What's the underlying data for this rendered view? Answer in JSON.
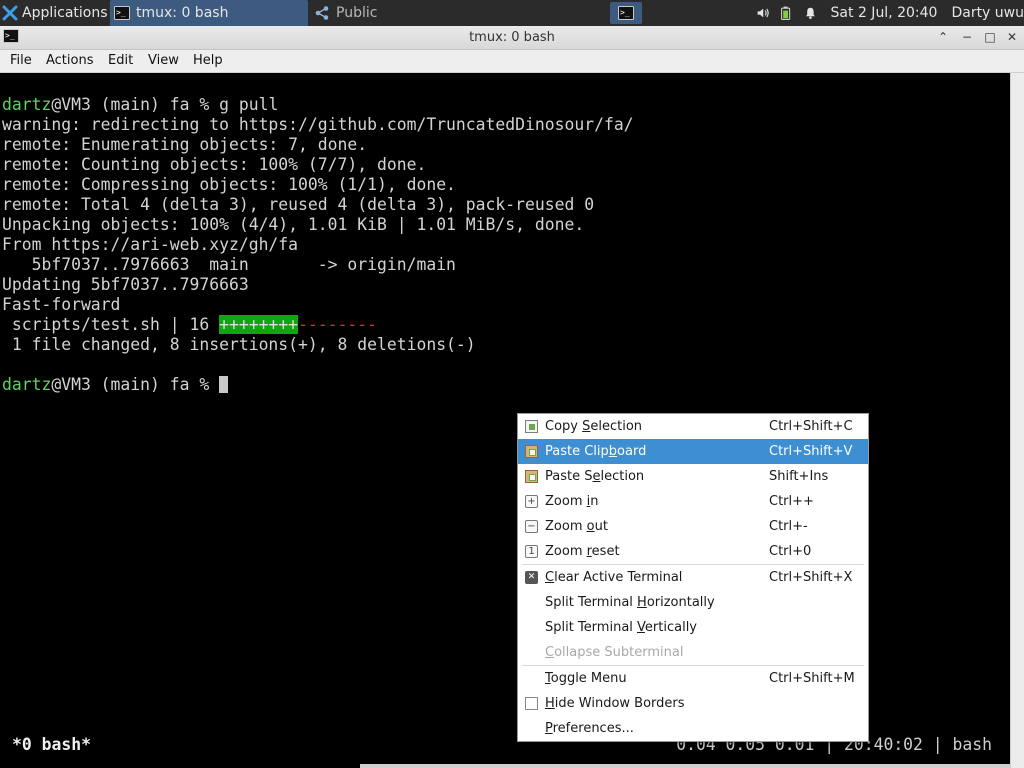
{
  "panel": {
    "apps_label": "Applications",
    "task1_label": "tmux: 0 bash",
    "task2_label": "Public",
    "terminal_glyph": ">_",
    "clock": "Sat  2 Jul, 20:40",
    "user": "Darty uwu",
    "icons": [
      "applications-icon",
      "terminal-icon",
      "share-icon",
      "volume-icon",
      "battery-icon",
      "notification-bell-icon"
    ]
  },
  "window": {
    "title": "tmux: 0 bash",
    "controls": {
      "up": "⌃",
      "minimize": "−",
      "maximize": "□",
      "close": "✕"
    }
  },
  "menubar": {
    "items": [
      "File",
      "Actions",
      "Edit",
      "View",
      "Help"
    ]
  },
  "terminal": {
    "prompt_user": "dartz",
    "prompt_rest": "@VM3 (main) fa % ",
    "command": "g pull",
    "lines": [
      "warning: redirecting to https://github.com/TruncatedDinosour/fa/",
      "remote: Enumerating objects: 7, done.",
      "remote: Counting objects: 100% (7/7), done.",
      "remote: Compressing objects: 100% (1/1), done.",
      "remote: Total 4 (delta 3), reused 4 (delta 3), pack-reused 0",
      "Unpacking objects: 100% (4/4), 1.01 KiB | 1.01 MiB/s, done.",
      "From https://ari-web.xyz/gh/fa",
      "   5bf7037..7976663  main       -> origin/main",
      "Updating 5bf7037..7976663",
      "Fast-forward"
    ],
    "diffstat_prefix": " scripts/test.sh | 16 ",
    "diffstat_plus": "++++++++",
    "diffstat_minus": "--------",
    "summary": " 1 file changed, 8 insertions(+), 8 deletions(-)",
    "prompt2_user": "dartz",
    "prompt2_rest": "@VM3 (main) fa % "
  },
  "status": {
    "left": "*0 bash*",
    "right": "0.04 0.05 0.01 | 20:40:02 | bash"
  },
  "context_menu": {
    "copy_selection": {
      "pre": "Copy ",
      "u": "S",
      "post": "election",
      "shortcut": "Ctrl+Shift+C"
    },
    "paste_clipboard": {
      "pre": "Paste Clip",
      "u": "b",
      "post": "oard",
      "shortcut": "Ctrl+Shift+V"
    },
    "paste_selection": {
      "pre": "Paste S",
      "u": "e",
      "post": "lection",
      "shortcut": "Shift+Ins"
    },
    "zoom_in": {
      "pre": "Zoom ",
      "u": "i",
      "post": "n",
      "shortcut": "Ctrl++"
    },
    "zoom_out": {
      "pre": "Zoom ",
      "u": "o",
      "post": "ut",
      "shortcut": "Ctrl+-"
    },
    "zoom_reset": {
      "pre": "Zoom ",
      "u": "r",
      "post": "eset",
      "shortcut": "Ctrl+0"
    },
    "clear_terminal": {
      "pre": "",
      "u": "C",
      "post": "lear Active Terminal",
      "shortcut": "Ctrl+Shift+X"
    },
    "split_h": {
      "pre": "Split Terminal ",
      "u": "H",
      "post": "orizontally"
    },
    "split_v": {
      "pre": "Split Terminal ",
      "u": "V",
      "post": "ertically"
    },
    "collapse": {
      "pre": "",
      "u": "C",
      "post": "ollapse Subterminal"
    },
    "toggle_menu": {
      "pre": "",
      "u": "T",
      "post": "oggle Menu",
      "shortcut": "Ctrl+Shift+M"
    },
    "hide_borders": {
      "pre": "",
      "u": "H",
      "post": "ide Window Borders"
    },
    "preferences": {
      "pre": "",
      "u": "P",
      "post": "references..."
    }
  },
  "colors": {
    "panel_bg": "#2b2b2b",
    "task_active": "#3d5a80",
    "prompt_green": "#5fd35f",
    "diff_plus_bg": "#0ea80e",
    "diff_minus": "#d83131",
    "menu_highlight": "#3d8fd1"
  }
}
